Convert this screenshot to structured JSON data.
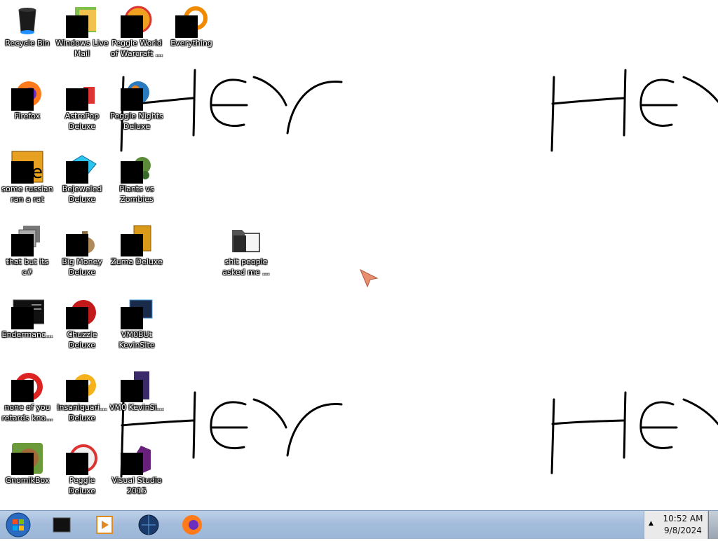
{
  "desktop": {
    "wallpaper_text": "Hey",
    "icons": [
      {
        "label": "Recycle Bin",
        "icon": "recycle-bin-icon",
        "censored": false
      },
      {
        "label": "Windows Live Mail",
        "icon": "windows-live-mail-icon",
        "censored": true
      },
      {
        "label": "Peggle World of Warcraft ...",
        "icon": "peggle-icon",
        "censored": true
      },
      {
        "label": "Everything",
        "icon": "everything-search-icon",
        "censored": true
      },
      {
        "label": "Firefox",
        "icon": "firefox-icon",
        "censored": true
      },
      {
        "label": "AstroPop Deluxe",
        "icon": "astropop-icon",
        "censored": true
      },
      {
        "label": "Peggle Nights Deluxe",
        "icon": "peggle-nights-icon",
        "censored": true
      },
      {
        "label": "some russian ran a rat",
        "icon": "orange-app-icon",
        "censored": true
      },
      {
        "label": "Bejeweled Deluxe",
        "icon": "bejeweled-gem-icon",
        "censored": true
      },
      {
        "label": "Plants vs Zombies",
        "icon": "plants-vs-zombies-icon",
        "censored": true
      },
      {
        "label": "that but its c#",
        "icon": "shortcut-stack-icon",
        "censored": true
      },
      {
        "label": "Big Money Deluxe",
        "icon": "money-bag-icon",
        "censored": true
      },
      {
        "label": "Zuma Deluxe",
        "icon": "zuma-icon",
        "censored": true
      },
      {
        "label": "shit people asked me ...",
        "icon": "folder-icon",
        "censored": false
      },
      {
        "label": "Endermanc...",
        "icon": "terminal-icon",
        "censored": true
      },
      {
        "label": "Chuzzle Deluxe",
        "icon": "chuzzle-icon",
        "censored": true
      },
      {
        "label": "VM0BUt KevinSite",
        "icon": "vm-monitor-icon",
        "censored": true
      },
      {
        "label": "none of you retards kno...",
        "icon": "red-disc-icon",
        "censored": true
      },
      {
        "label": "Insaniquari... Deluxe",
        "icon": "insaniquarium-fish-icon",
        "censored": true
      },
      {
        "label": "VM0 KevinSi...",
        "icon": "purple-app-icon",
        "censored": true
      },
      {
        "label": "GnomikBox",
        "icon": "gnomik-box-icon",
        "censored": true
      },
      {
        "label": "Peggle Deluxe",
        "icon": "peggle-deluxe-icon",
        "censored": true
      },
      {
        "label": "Visual Studio 2015",
        "icon": "visual-studio-icon",
        "censored": true
      }
    ]
  },
  "taskbar": {
    "pinned": [
      {
        "name": "taskbar-terminal",
        "icon": "terminal-icon"
      },
      {
        "name": "taskbar-media-player",
        "icon": "media-player-icon"
      },
      {
        "name": "taskbar-globe",
        "icon": "globe-icon"
      },
      {
        "name": "taskbar-firefox",
        "icon": "firefox-icon"
      }
    ],
    "tray": {
      "time": "10:52 AM",
      "date": "9/8/2024"
    }
  },
  "colors": {
    "taskbar": "#a3bcdb",
    "icon_label": "#ffffff",
    "handwriting": "#000000",
    "cursor": "#e98f6f"
  }
}
